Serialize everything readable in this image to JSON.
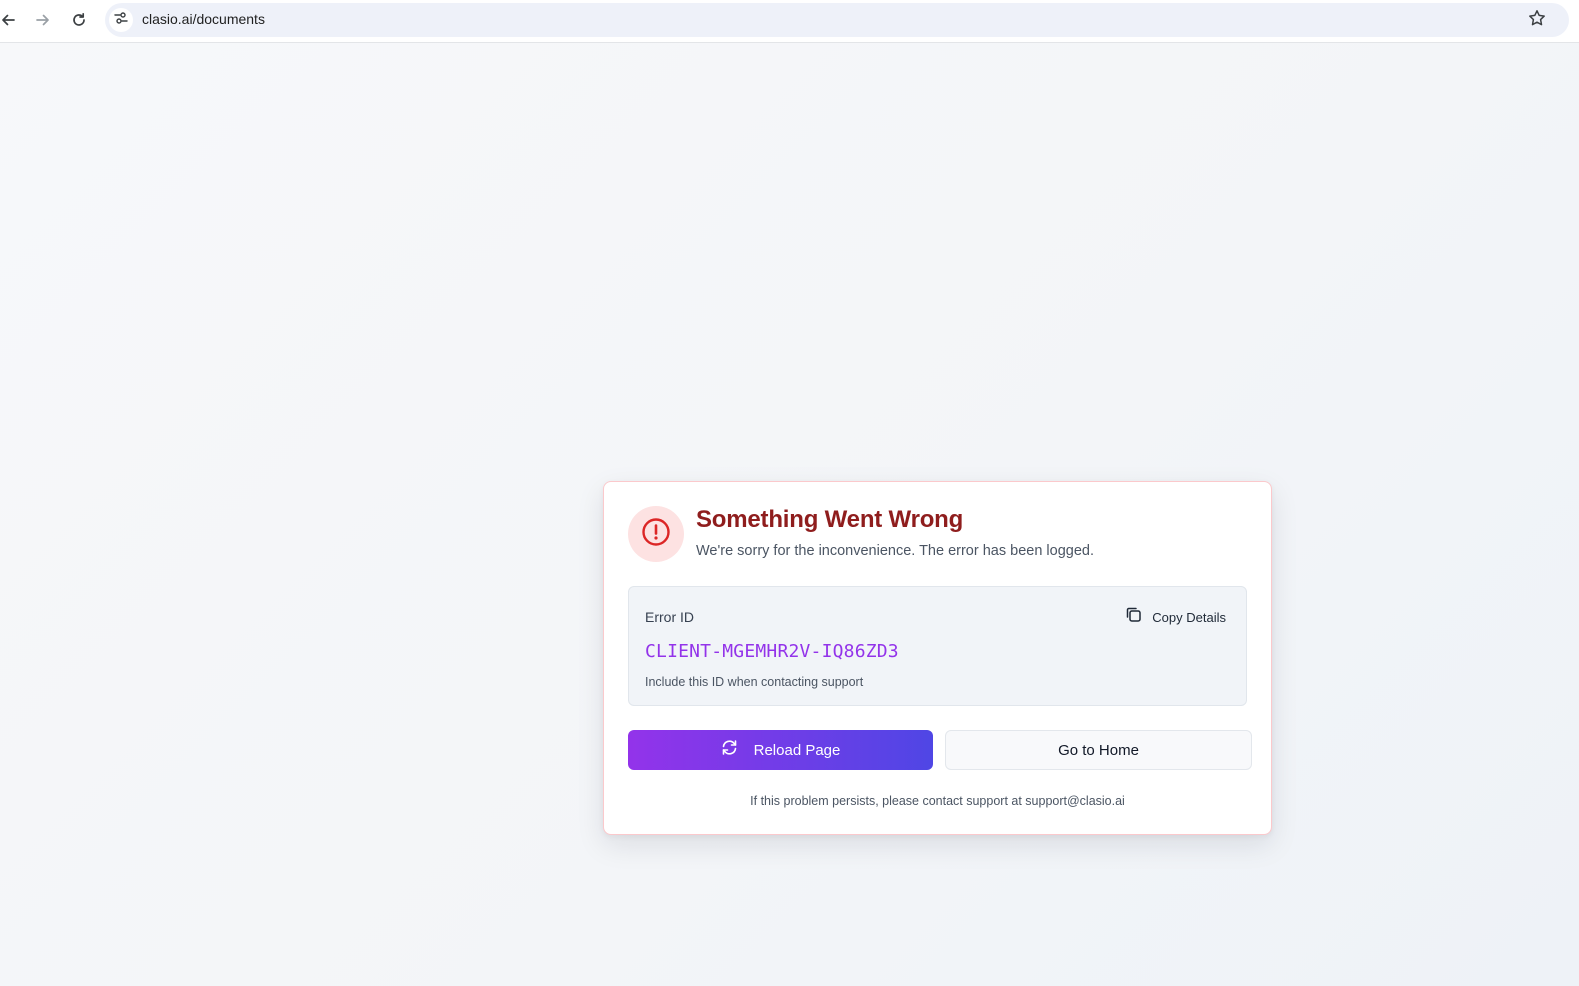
{
  "browser": {
    "url": "clasio.ai/documents",
    "icons": {
      "back": "arrow-left",
      "forward": "arrow-right",
      "reload": "refresh",
      "site_info": "tune-sliders",
      "bookmark": "star-outline"
    }
  },
  "error_card": {
    "title": "Something Went Wrong",
    "subtitle": "We're sorry for the inconvenience. The error has been logged.",
    "alert_icon": "alert-circle",
    "error_id_label": "Error ID",
    "copy_button_label": "Copy Details",
    "copy_icon": "copy",
    "error_id": "CLIENT-MGEMHR2V-IQ86ZD3",
    "error_id_hint": "Include this ID when contacting support",
    "reload_button_label": "Reload Page",
    "reload_icon": "refresh-cw",
    "home_button_label": "Go to Home",
    "footer": "If this problem persists, please contact support at support@clasio.ai"
  },
  "colors": {
    "title": "#8f1d1d",
    "alert_bg": "#fde2e2",
    "alert_icon": "#dc2626",
    "error_id": "#9333ea",
    "primary_gradient_start": "#9333ea",
    "primary_gradient_end": "#4f46e5",
    "card_border": "#fbc9cc"
  }
}
